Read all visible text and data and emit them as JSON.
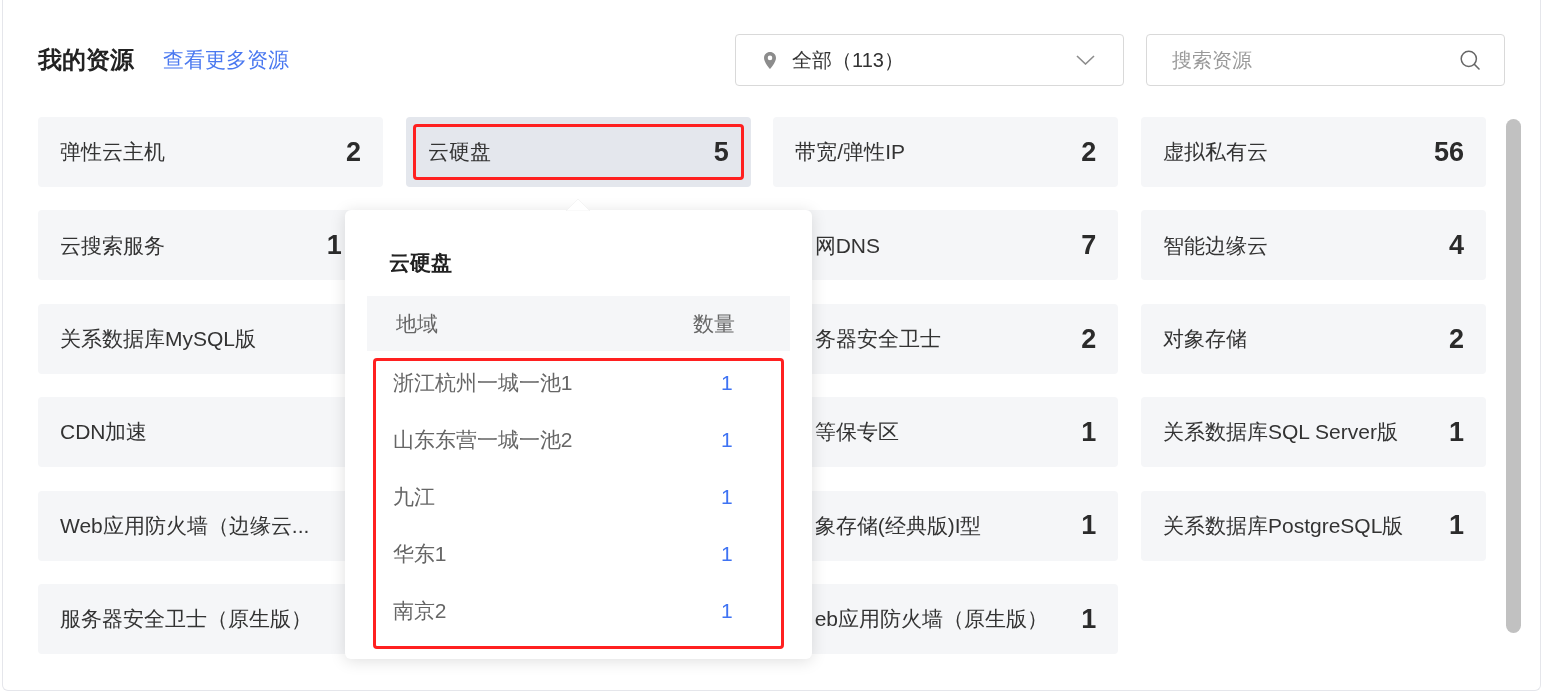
{
  "header": {
    "title": "我的资源",
    "more_link": "查看更多资源"
  },
  "region_filter": {
    "value": "全部（113）"
  },
  "search": {
    "placeholder": "搜索资源"
  },
  "resource_grid": {
    "columns": [
      [
        {
          "name": "弹性云主机",
          "count": "2",
          "selected": false,
          "highlighted": false
        },
        {
          "name": "云搜索服务",
          "count": "1",
          "selected": false,
          "highlighted": false
        },
        {
          "name": "关系数据库MySQL版",
          "selected": false,
          "highlighted": false
        },
        {
          "name": "CDN加速",
          "selected": false,
          "highlighted": false
        },
        {
          "name": "Web应用防火墙（边缘云...",
          "selected": false,
          "highlighted": false
        },
        {
          "name": "服务器安全卫士（原生版）",
          "selected": false,
          "highlighted": false
        }
      ],
      [
        {
          "name": "云硬盘",
          "count": "5",
          "selected": true,
          "highlighted": true
        }
      ],
      [
        {
          "name": "带宽/弹性IP",
          "count": "2",
          "selected": false,
          "highlighted": false
        },
        {
          "name": "网DNS",
          "count": "7",
          "selected": false,
          "highlighted": false
        },
        {
          "name": "务器安全卫士",
          "count": "2",
          "selected": false,
          "highlighted": false
        },
        {
          "name": "等保专区",
          "count": "1",
          "selected": false,
          "highlighted": false
        },
        {
          "name": "象存储(经典版)I型",
          "count": "1",
          "selected": false,
          "highlighted": false
        },
        {
          "name": "eb应用防火墙（原生版）",
          "count": "1",
          "selected": false,
          "highlighted": false
        }
      ],
      [
        {
          "name": "虚拟私有云",
          "count": "56",
          "selected": false,
          "highlighted": false
        },
        {
          "name": "智能边缘云",
          "count": "4",
          "selected": false,
          "highlighted": false
        },
        {
          "name": "对象存储",
          "count": "2",
          "selected": false,
          "highlighted": false
        },
        {
          "name": "关系数据库SQL Server版",
          "count": "1",
          "selected": false,
          "highlighted": false
        },
        {
          "name": "关系数据库PostgreSQL版",
          "count": "1",
          "selected": false,
          "highlighted": false
        }
      ]
    ]
  },
  "popover": {
    "title": "云硬盘",
    "columns": [
      "地域",
      "数量"
    ],
    "rows_highlighted": true,
    "rows": [
      {
        "region": "浙江杭州一城一池1",
        "count": "1"
      },
      {
        "region": "山东东营一城一池2",
        "count": "1"
      },
      {
        "region": "九江",
        "count": "1"
      },
      {
        "region": "华东1",
        "count": "1"
      },
      {
        "region": "南京2",
        "count": "1"
      }
    ]
  }
}
